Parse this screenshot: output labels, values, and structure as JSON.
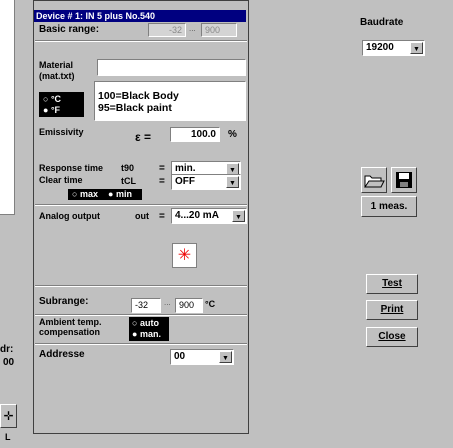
{
  "dialog": {
    "title": "Device # 1: IN 5 plus  No.540",
    "basic_range": {
      "label": "Basic range:",
      "from": "-32",
      "sep": "...",
      "to": "900"
    },
    "material": {
      "label_1": "Material",
      "label_2": "(mat.txt)",
      "value": "",
      "list": [
        "100=Black Body",
        "95=Black paint"
      ]
    },
    "temp_unit": {
      "celsius": "°C",
      "fahrenheit": "°F"
    },
    "emissivity": {
      "label": "Emissivity",
      "symbol": "ε  =",
      "value": "100.0",
      "unit": "%"
    },
    "response_time": {
      "label": "Response time",
      "code": "t90",
      "eq": "=",
      "value": "min."
    },
    "clear_time": {
      "label": "Clear time",
      "code": "tCL",
      "eq": "=",
      "value": "OFF"
    },
    "max_min": {
      "max": "max",
      "min": "min"
    },
    "analog_output": {
      "label": "Analog output",
      "code": "out",
      "eq": "=",
      "value": "4...20 mA"
    },
    "subrange": {
      "label": "Subrange:",
      "from": "-32",
      "sep": "...",
      "to": "900",
      "unit": "°C"
    },
    "ambient": {
      "label_1": "Ambient temp.",
      "label_2": "compensation",
      "auto": "auto",
      "man": "man."
    },
    "address": {
      "label": "Addresse",
      "value": "00"
    }
  },
  "right": {
    "baudrate_label": "Baudrate",
    "baudrate_value": "19200",
    "meas_button": "1 meas.",
    "test_button": "Test",
    "print_button": "Print",
    "close_button": "Close"
  },
  "left": {
    "addr_label": "dr:",
    "addr_value": "00",
    "small_label": "L"
  }
}
